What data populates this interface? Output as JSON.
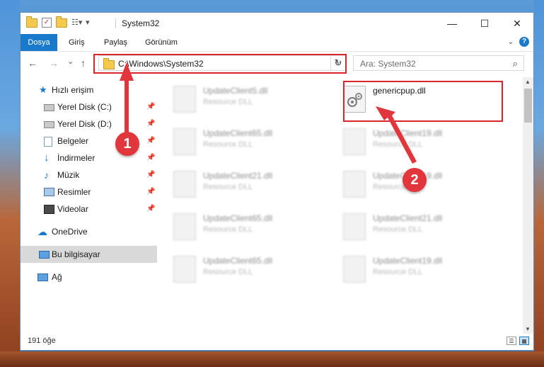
{
  "window": {
    "title": "System32",
    "controls": {
      "minimize": "—",
      "maximize": "☐",
      "close": "✕"
    }
  },
  "ribbon": {
    "tabs": [
      "Dosya",
      "Giriş",
      "Paylaş",
      "Görünüm"
    ]
  },
  "navigation": {
    "back": "←",
    "forward": "→",
    "recent": "⌄",
    "up": "↑",
    "address": "C:\\Windows\\System32",
    "refresh": "↻",
    "search_placeholder": "Ara: System32"
  },
  "sidebar": {
    "quick_access": "Hızlı erişim",
    "items": [
      {
        "label": "Yerel Disk (C:)",
        "icon": "drive-icon"
      },
      {
        "label": "Yerel Disk (D:)",
        "icon": "drive-icon"
      },
      {
        "label": "Belgeler",
        "icon": "documents-icon"
      },
      {
        "label": "İndirmeler",
        "icon": "downloads-icon"
      },
      {
        "label": "Müzik",
        "icon": "music-icon"
      },
      {
        "label": "Resimler",
        "icon": "pictures-icon"
      },
      {
        "label": "Videolar",
        "icon": "videos-icon"
      }
    ],
    "onedrive": "OneDrive",
    "this_pc": "Bu bilgisayar",
    "network": "Ağ"
  },
  "files": [
    {
      "name": "UpdateClient5.dll",
      "type": "Resource DLL"
    },
    {
      "name": "genericpup.dll",
      "type": ""
    },
    {
      "name": "UpdateClient65.dll",
      "type": "Resource DLL"
    },
    {
      "name": "UpdateClient19.dll",
      "type": "Resource DLL"
    },
    {
      "name": "UpdateClient21.dll",
      "type": "Resource DLL"
    },
    {
      "name": "UpdateClient19.dll",
      "type": "Resource DLL"
    },
    {
      "name": "UpdateClient65.dll",
      "type": "Resource DLL"
    },
    {
      "name": "UpdateClient21.dll",
      "type": "Resource DLL"
    },
    {
      "name": "UpdateClient65.dll",
      "type": "Resource DLL"
    },
    {
      "name": "UpdateClient19.dll",
      "type": "Resource DLL"
    }
  ],
  "status": {
    "item_count": "191 öğe"
  },
  "annotations": {
    "marker1": "1",
    "marker2": "2"
  },
  "colors": {
    "accent": "#1979ca",
    "highlight": "#d9262c",
    "marker": "#e0363c"
  }
}
